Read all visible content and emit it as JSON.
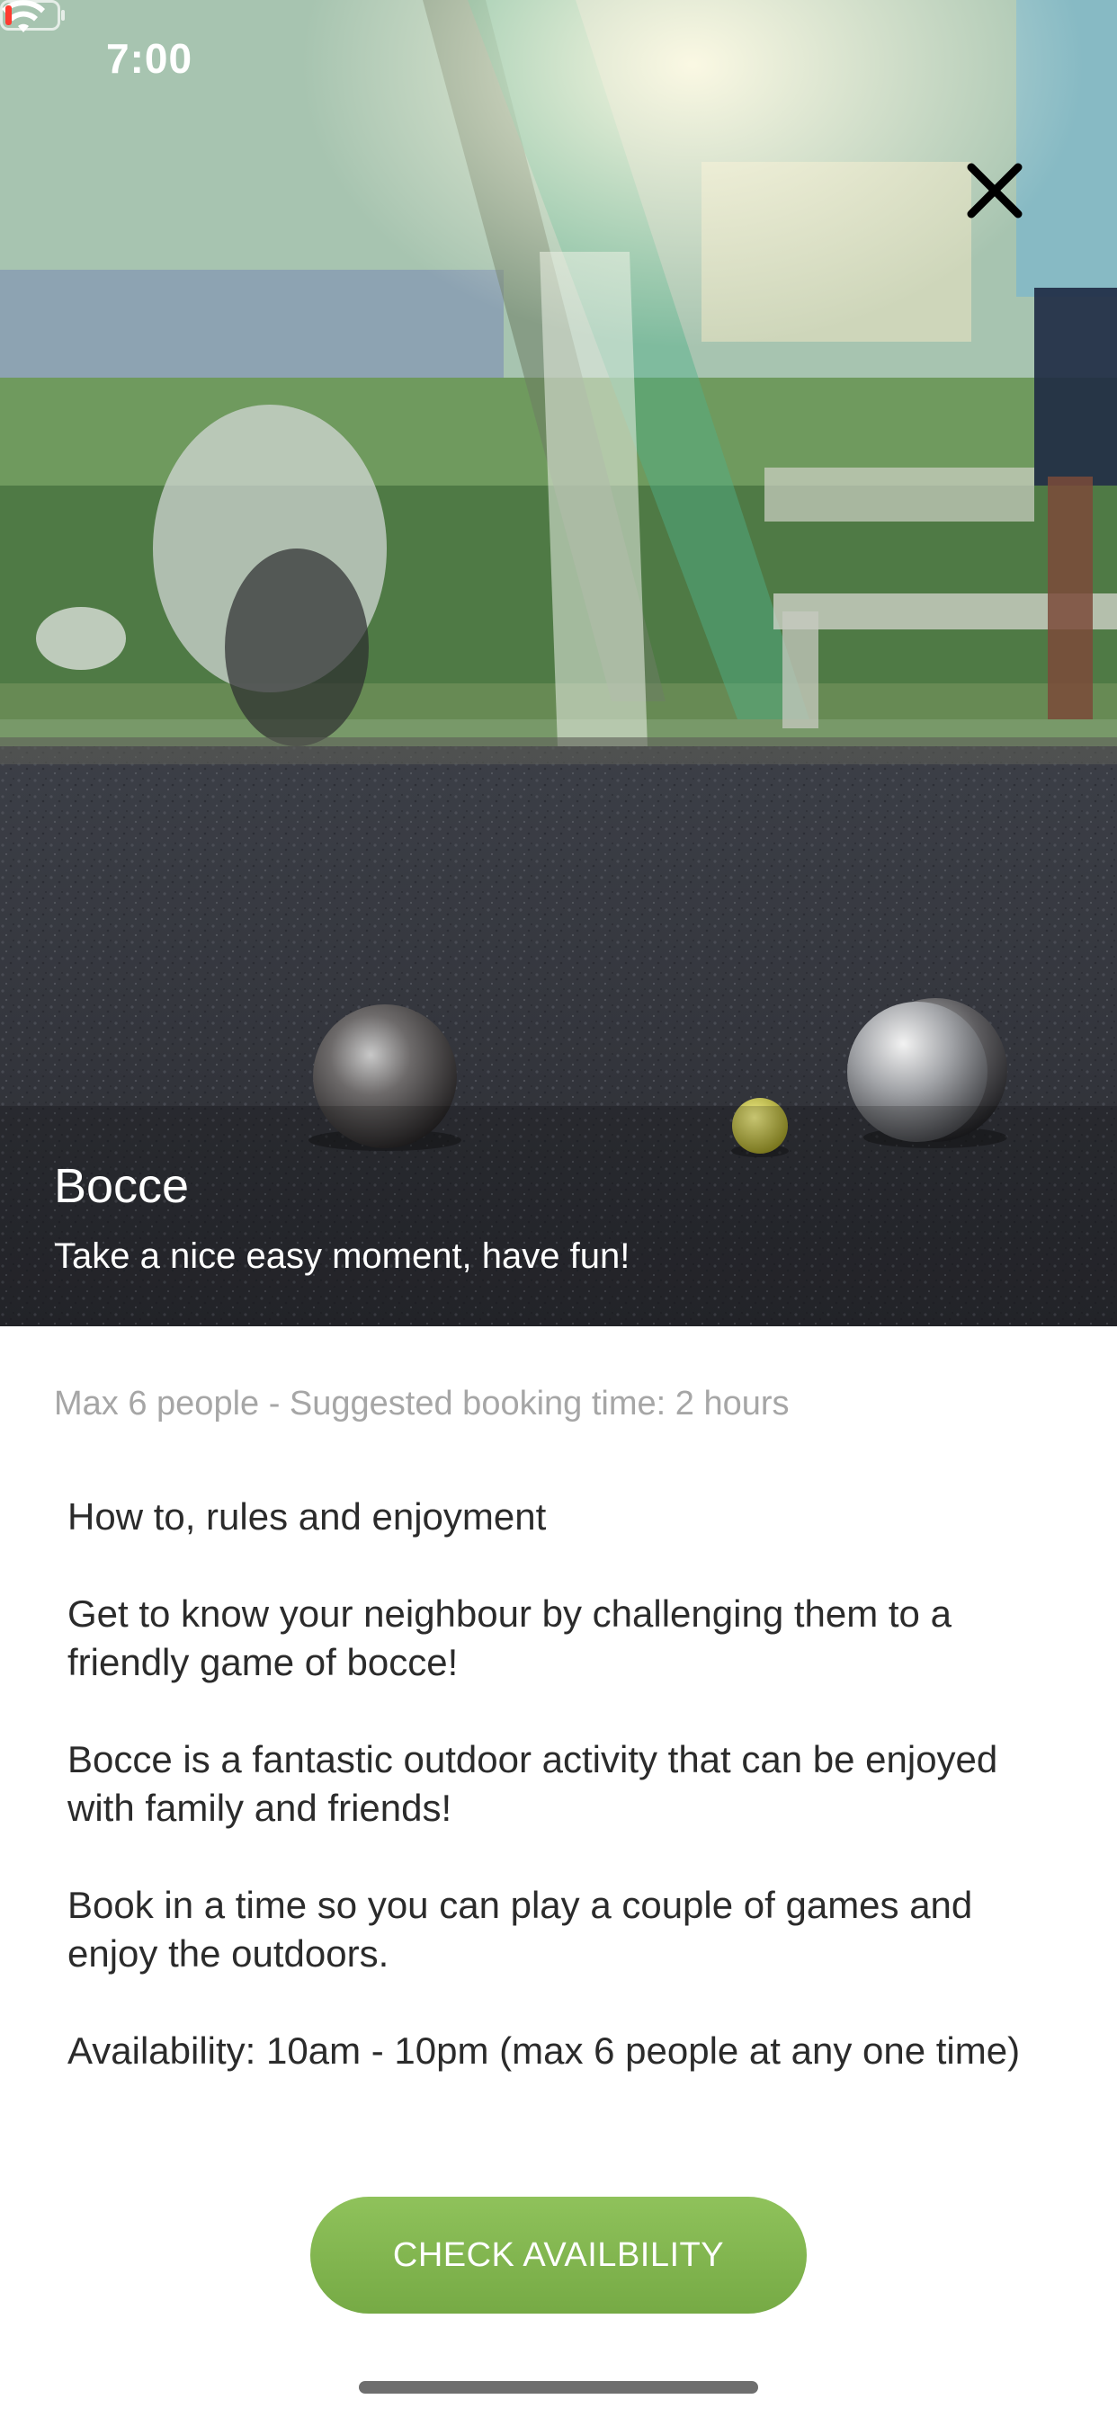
{
  "status_bar": {
    "time": "7:00",
    "wifi_icon": "wifi-icon",
    "battery_icon": "battery-low-icon",
    "battery_color": "#ff3b30"
  },
  "hero": {
    "close_icon": "close-icon",
    "title": "Bocce",
    "subtitle": "Take a nice easy moment, have fun!"
  },
  "details": {
    "meta": "Max 6 people - Suggested booking time: 2 hours",
    "paragraphs": [
      "How to, rules and enjoyment",
      "Get to know your neighbour by challenging them to a friendly game of bocce!",
      "Bocce is a fantastic outdoor activity that can be enjoyed with family and friends!",
      "Book in a time so you can play a couple of games and enjoy the outdoors.",
      "Availability: 10am - 10pm (max 6 people at any one time)"
    ]
  },
  "cta": {
    "label": "CHECK AVAILBILITY",
    "color": "#80b44f"
  }
}
